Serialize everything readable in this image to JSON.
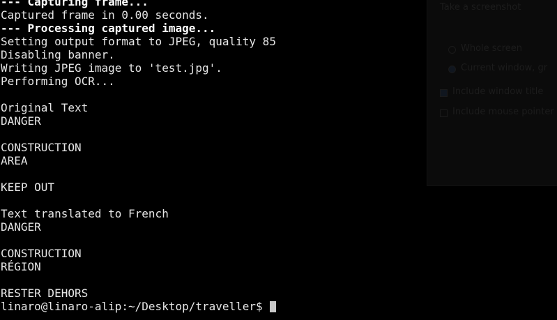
{
  "terminal": {
    "lines": [
      {
        "text": "--- Capturing frame...",
        "bold": true
      },
      {
        "text": "Captured frame in 0.00 seconds.",
        "bold": false
      },
      {
        "text": "--- Processing captured image...",
        "bold": true
      },
      {
        "text": "Setting output format to JPEG, quality 85",
        "bold": false
      },
      {
        "text": "Disabling banner.",
        "bold": false
      },
      {
        "text": "Writing JPEG image to 'test.jpg'.",
        "bold": false
      },
      {
        "text": "Performing OCR...",
        "bold": false
      },
      {
        "text": "",
        "bold": false
      },
      {
        "text": "Original Text",
        "bold": false
      },
      {
        "text": "DANGER",
        "bold": false
      },
      {
        "text": "",
        "bold": false
      },
      {
        "text": "CONSTRUCTION",
        "bold": false
      },
      {
        "text": "AREA",
        "bold": false
      },
      {
        "text": "",
        "bold": false
      },
      {
        "text": "KEEP OUT",
        "bold": false
      },
      {
        "text": "",
        "bold": false
      },
      {
        "text": "Text translated to French",
        "bold": false
      },
      {
        "text": "DANGER",
        "bold": false
      },
      {
        "text": "",
        "bold": false
      },
      {
        "text": "CONSTRUCTION",
        "bold": false
      },
      {
        "text": "RÉGION",
        "bold": false
      },
      {
        "text": "",
        "bold": false
      },
      {
        "text": "RESTER DEHORS",
        "bold": false
      }
    ],
    "prompt": "linaro@linaro-alip:~/Desktop/traveller$ ",
    "colors": {
      "background": "#000000",
      "text": "#e6e6e6",
      "bold_text": "#ffffff",
      "cursor": "#c8c8c8"
    }
  },
  "ghost_dialog": {
    "title": "Take a screenshot",
    "option_whole_screen": "Whole screen",
    "option_current_window": "Current window, gr",
    "check_window_title": "Include window title",
    "check_mouse_pointer": "Include mouse pointer"
  }
}
